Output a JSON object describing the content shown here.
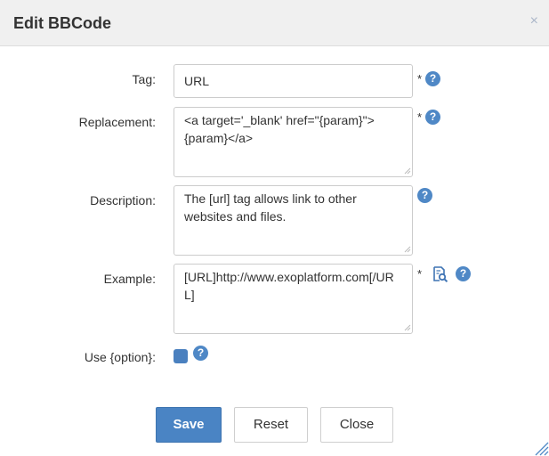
{
  "dialog": {
    "title": "Edit BBCode",
    "close_glyph": "×"
  },
  "form": {
    "tag": {
      "label": "Tag:",
      "value": "URL",
      "required_mark": "*"
    },
    "replacement": {
      "label": "Replacement:",
      "value": "<a target='_blank' href=\"{param}\">{param}</a>",
      "required_mark": "*"
    },
    "description": {
      "label": "Description:",
      "value": "The [url] tag allows link to other websites and files."
    },
    "example": {
      "label": "Example:",
      "value": "[URL]http://www.exoplatform.com[/URL]",
      "required_mark": "*"
    },
    "use_option": {
      "label": "Use {option}:",
      "checked": true
    }
  },
  "help_glyph": "?",
  "buttons": {
    "save": "Save",
    "reset": "Reset",
    "close": "Close"
  },
  "colors": {
    "accent": "#4a84c4",
    "help_icon": "#4f88c6",
    "header_bg": "#f0f0f0"
  },
  "icons": {
    "help": "question-circle",
    "preview": "search-document",
    "close": "times"
  }
}
